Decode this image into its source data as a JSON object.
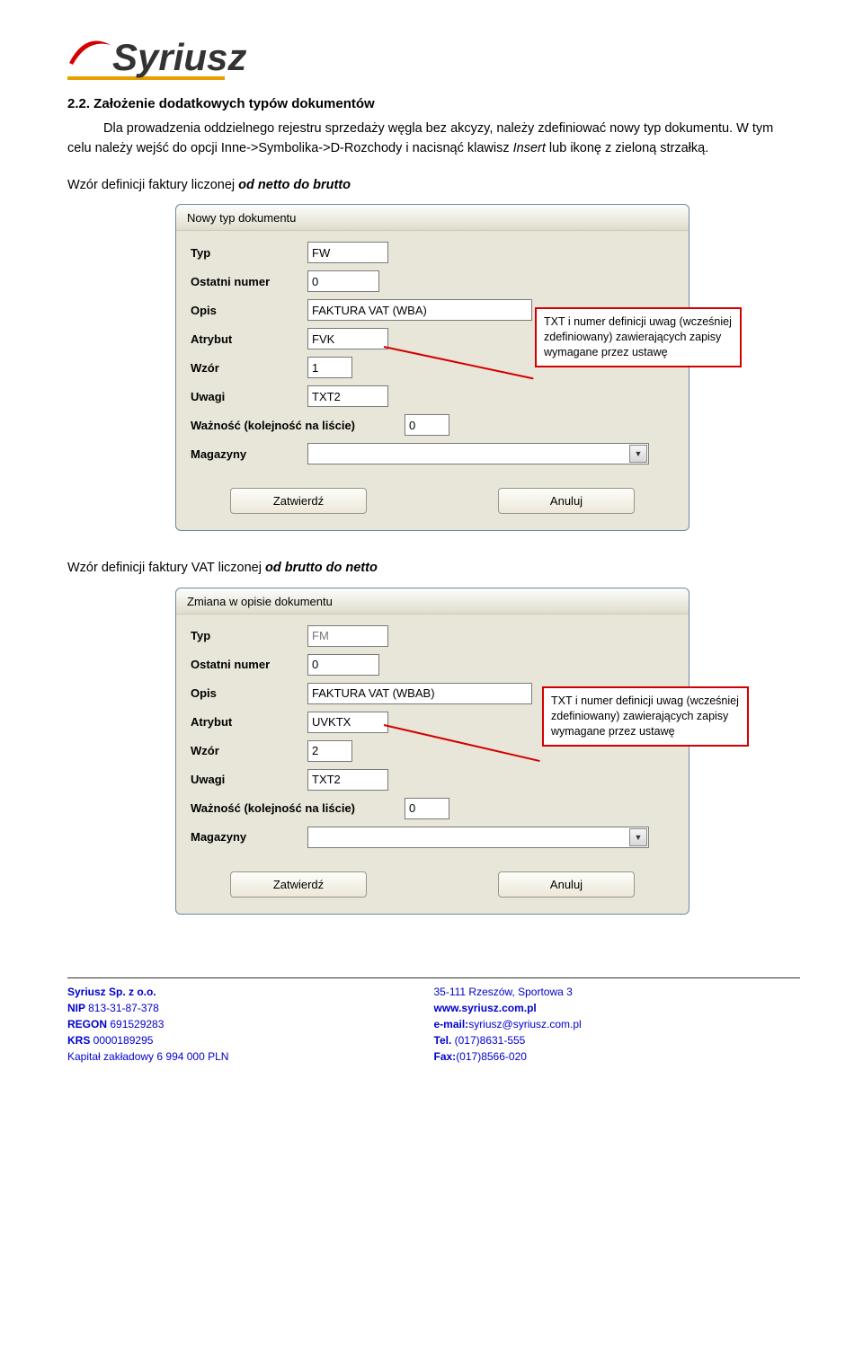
{
  "logo": {
    "text": "Syriusz"
  },
  "section": {
    "heading": "2.2. Założenie dodatkowych typów dokumentów",
    "para1": "Dla prowadzenia oddzielnego rejestru sprzedaży węgla bez akcyzy, należy zdefiniować nowy typ dokumentu. W tym celu należy wejść do opcji Inne->Symbolika->D-Rozchody i nacisnąć klawisz ",
    "para1_em": "Insert",
    "para1_tail": " lub ikonę z zieloną strzałką.",
    "caption1_a": "Wzór definicji faktury liczonej ",
    "caption1_b": "od netto do brutto",
    "caption2_a": "Wzór definicji faktury VAT liczonej  ",
    "caption2_b": "od brutto do netto"
  },
  "dialog1": {
    "title": "Nowy typ dokumentu",
    "labels": {
      "typ": "Typ",
      "ostatni": "Ostatni numer",
      "opis": "Opis",
      "atrybut": "Atrybut",
      "wzor": "Wzór",
      "uwagi": "Uwagi",
      "waznosc": "Ważność (kolejność na liście)",
      "magazyny": "Magazyny"
    },
    "values": {
      "typ": "FW",
      "ostatni": "0",
      "opis": "FAKTURA VAT (WBA)",
      "atrybut": "FVK",
      "wzor": "1",
      "uwagi": "TXT2",
      "waznosc": "0"
    },
    "buttons": {
      "ok": "Zatwierdź",
      "cancel": "Anuluj"
    }
  },
  "dialog2": {
    "title": "Zmiana w opisie dokumentu",
    "labels": {
      "typ": "Typ",
      "ostatni": "Ostatni numer",
      "opis": "Opis",
      "atrybut": "Atrybut",
      "wzor": "Wzór",
      "uwagi": "Uwagi",
      "waznosc": "Ważność (kolejność na liście)",
      "magazyny": "Magazyny"
    },
    "values": {
      "typ": "FM",
      "ostatni": "0",
      "opis": "FAKTURA VAT (WBAB)",
      "atrybut": "UVKTX",
      "wzor": "2",
      "uwagi": "TXT2",
      "waznosc": "0"
    },
    "buttons": {
      "ok": "Zatwierdź",
      "cancel": "Anuluj"
    }
  },
  "callout": {
    "text": "TXT i numer definicji uwag (wcześniej zdefiniowany) zawierających zapisy wymagane przez ustawę"
  },
  "footer": {
    "company": "Syriusz Sp. z o.o.",
    "nip_l": "NIP ",
    "nip_v": "813-31-87-378",
    "regon_l": "REGON ",
    "regon_v": "691529283",
    "krs_l": "KRS ",
    "krs_v": "0000189295",
    "capital": "Kapitał zakładowy 6 994 000 PLN",
    "addr": "35-111 Rzeszów, Sportowa 3",
    "www": "www.syriusz.com.pl",
    "email_l": "e-mail:",
    "email_v": "syriusz@syriusz.com.pl",
    "tel_l": "Tel. ",
    "tel_v": "(017)8631-555",
    "fax_l": "Fax:",
    "fax_v": "(017)8566-020"
  }
}
